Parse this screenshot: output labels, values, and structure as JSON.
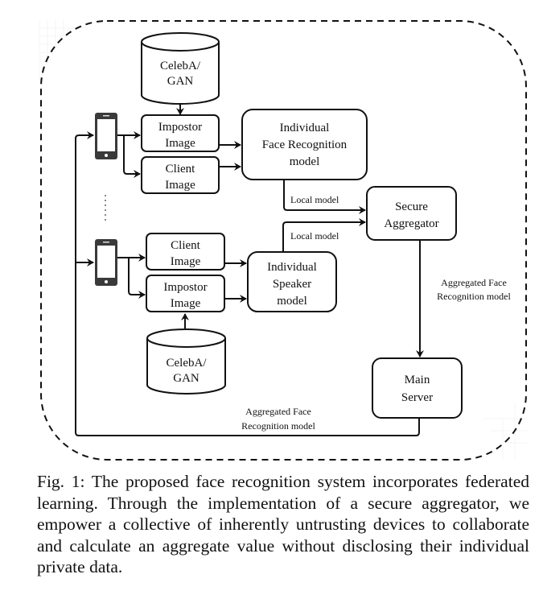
{
  "figure": {
    "nodes": {
      "db_top": {
        "line1": "CelebA/",
        "line2": "GAN"
      },
      "impostor_top": {
        "line1": "Impostor",
        "line2": "Image"
      },
      "client_top": {
        "line1": "Client",
        "line2": "Image"
      },
      "face_model": {
        "line1": "Individual",
        "line2": "Face Recognition",
        "line3": "model"
      },
      "client_bottom": {
        "line1": "Client",
        "line2": "Image"
      },
      "impostor_bottom": {
        "line1": "Impostor",
        "line2": "Image"
      },
      "speaker_model": {
        "line1": "Individual",
        "line2": "Speaker",
        "line3": "model"
      },
      "db_bottom": {
        "line1": "CelebA/",
        "line2": "GAN"
      },
      "aggregator": {
        "line1": "Secure",
        "line2": "Aggregator"
      },
      "main_server": {
        "line1": "Main",
        "line2": "Server"
      }
    },
    "edges": {
      "local_model_top": "Local model",
      "local_model_bottom": "Local model",
      "aggregated_right": {
        "line1": "Aggregated Face",
        "line2": "Recognition model"
      },
      "aggregated_bottom": {
        "line1": "Aggregated Face",
        "line2": "Recognition model"
      }
    },
    "devices": [
      "phone-icon",
      "phone-icon"
    ],
    "ellipsis": "vertical-dots"
  },
  "caption": "Fig. 1: The proposed face recognition system incorporates federated learning. Through the implementation of a secure aggregator, we empower a collective of inherently untrusting devices to collaborate and calculate an aggregate value without disclosing their individual private data."
}
